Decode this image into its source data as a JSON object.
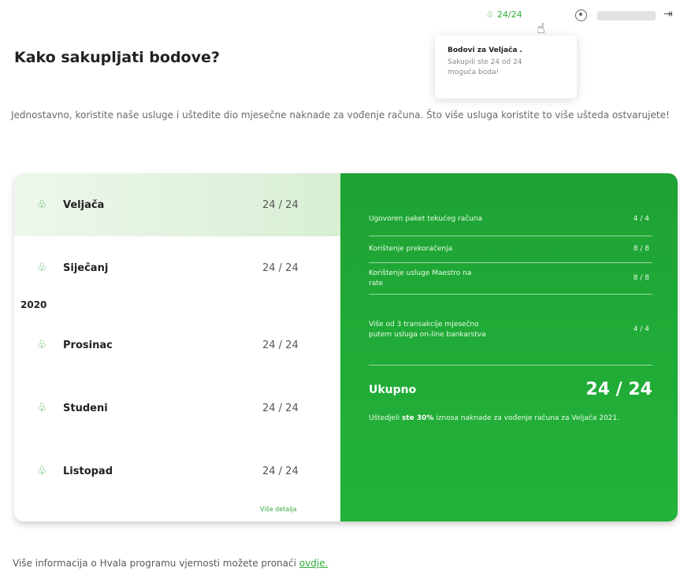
{
  "header": {
    "points_badge": "24/24",
    "user_name": "",
    "icons": {
      "points": "leaf-pot-icon",
      "user": "user-icon",
      "logout": "logout-icon",
      "cursor": "hand-cursor-icon"
    }
  },
  "tooltip": {
    "title": "Bodovi za Veljača .",
    "body": "Sakupili ste 24 od 24 moguća boda!"
  },
  "page": {
    "title": "Kako sakupljati bodove?",
    "intro": "Jednostavno, koristite naše usluge i uštedite dio mjesečne naknade za vođenje računa. Što više usluga koristite to više ušteda ostvarujete!"
  },
  "months": {
    "year_label": "2020",
    "rows": [
      {
        "label": "Veljača",
        "score": "24 / 24",
        "active": true
      },
      {
        "label": "Siječanj",
        "score": "24 / 24",
        "active": false
      },
      {
        "label": "Prosinac",
        "score": "24 / 24",
        "active": false
      },
      {
        "label": "Studeni",
        "score": "24 / 24",
        "active": false
      },
      {
        "label": "Listopad",
        "score": "24 / 24",
        "active": false
      }
    ],
    "details_link": "Više detalja"
  },
  "detail": {
    "items": [
      {
        "label": "Ugovoren paket tekućeg računa",
        "score": "4 / 4"
      },
      {
        "label": "Korištenje prekoračenja",
        "score": "8 / 8"
      },
      {
        "label": "Korištenje usluge Maestro na rate",
        "score": "8 / 8"
      },
      {
        "label": "Više od 3 transakcije mjesečno putem usluga on-line bankarstva",
        "score": "4 / 4"
      }
    ],
    "total_label": "Ukupno",
    "total_score": "24 / 24",
    "savings_prefix": "Uštedjeli ",
    "savings_bold": "ste 30%",
    "savings_suffix": " iznosa naknade za vođenje računa za Veljača 2021."
  },
  "footer": {
    "text": "Više informacija o Hvala programu vjernosti možete pronaći ",
    "link": "ovdje."
  },
  "colors": {
    "accent": "#2fae3b",
    "panel": "#1ea334"
  }
}
